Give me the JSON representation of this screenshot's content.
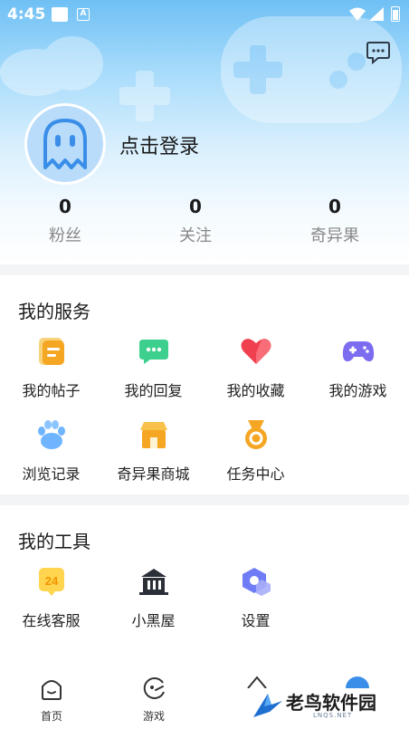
{
  "status_bar": {
    "time": "4:45",
    "indicator": "A"
  },
  "profile": {
    "login_text": "点击登录"
  },
  "stats": [
    {
      "count": "0",
      "label": "粉丝"
    },
    {
      "count": "0",
      "label": "关注"
    },
    {
      "count": "0",
      "label": "奇异果"
    }
  ],
  "services": {
    "title": "我的服务",
    "items": [
      {
        "label": "我的帖子",
        "icon": "post-icon"
      },
      {
        "label": "我的回复",
        "icon": "reply-icon"
      },
      {
        "label": "我的收藏",
        "icon": "favorite-icon"
      },
      {
        "label": "我的游戏",
        "icon": "gamepad-icon"
      },
      {
        "label": "浏览记录",
        "icon": "history-icon"
      },
      {
        "label": "奇异果商城",
        "icon": "store-icon"
      },
      {
        "label": "任务中心",
        "icon": "medal-icon"
      }
    ]
  },
  "tools": {
    "title": "我的工具",
    "items": [
      {
        "label": "在线客服",
        "icon": "customer-service-icon",
        "badge": "24"
      },
      {
        "label": "小黑屋",
        "icon": "house-icon"
      },
      {
        "label": "设置",
        "icon": "settings-icon"
      }
    ]
  },
  "tabbar": [
    {
      "label": "首页",
      "icon": "home-icon"
    },
    {
      "label": "游戏",
      "icon": "game-icon"
    }
  ],
  "watermark": {
    "text": "老鸟软件园",
    "sub": "LNQS.NET"
  },
  "colors": {
    "accent_blue": "#5aa9f5",
    "gradient_top": "#6fc0f5",
    "divider": "#f3f4f6"
  }
}
